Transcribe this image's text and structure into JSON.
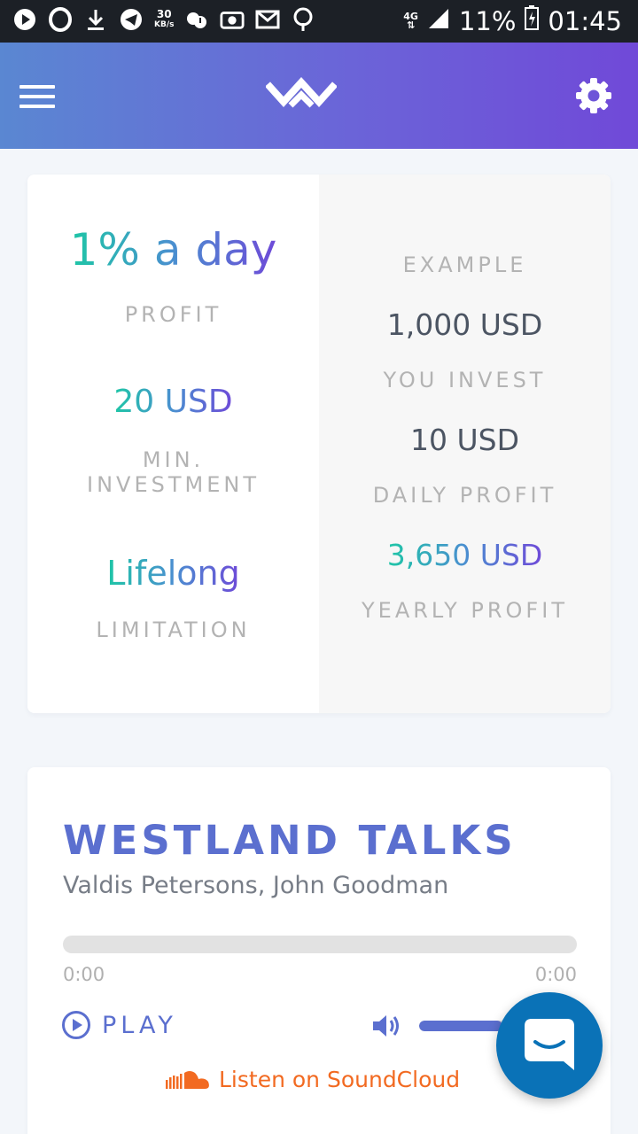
{
  "status_bar": {
    "net_speed": "30",
    "net_unit": "KB/s",
    "network": "4G",
    "battery": "11%",
    "time": "01:45"
  },
  "app_bar": {
    "menu_icon": "hamburger-menu-icon",
    "logo": "westland-logo",
    "settings_icon": "gear-icon"
  },
  "offer": {
    "profit": {
      "value_a": "1%",
      "value_b": " a day",
      "label": "PROFIT"
    },
    "min_investment": {
      "value": "20 USD",
      "label_line1": "MIN.",
      "label_line2": "INVESTMENT"
    },
    "limitation": {
      "value": "Lifelong",
      "label": "LIMITATION"
    },
    "example": {
      "heading": "EXAMPLE",
      "invest_value": "1,000 USD",
      "invest_label": "YOU INVEST",
      "daily_value": "10 USD",
      "daily_label": "DAILY PROFIT",
      "yearly_value": "3,650 USD",
      "yearly_label": "YEARLY PROFIT"
    }
  },
  "player": {
    "title": "WESTLAND TALKS",
    "subtitle": "Valdis Petersons, John Goodman",
    "time_current": "0:00",
    "time_total": "0:00",
    "progress": 0,
    "play_label": "PLAY",
    "volume": 0.8,
    "soundcloud_label": "Listen on SoundCloud"
  },
  "colors": {
    "accent": "#5b6fcf",
    "gradient_start": "#1ec6a6",
    "gradient_end": "#6e4ad8",
    "soundcloud": "#f26a21",
    "chat": "#0a72b7"
  }
}
